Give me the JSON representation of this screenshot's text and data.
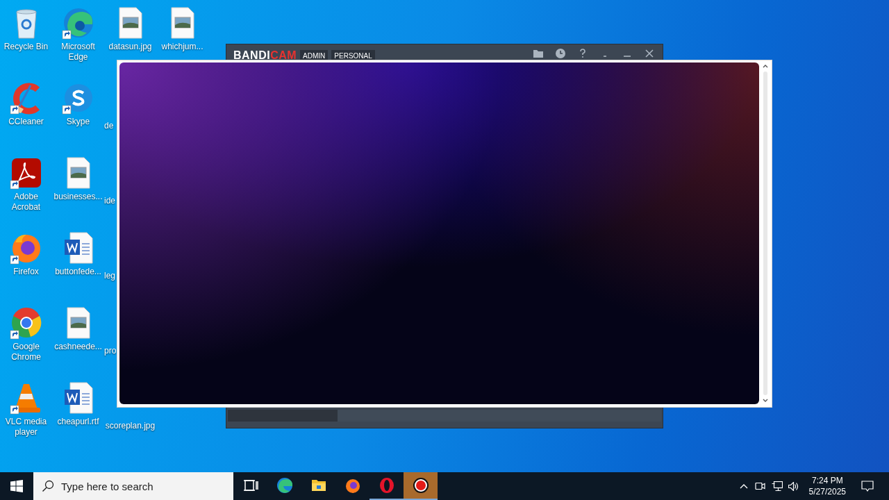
{
  "desktop": {
    "columns": [
      [
        {
          "label": "Recycle Bin",
          "kind": "bin",
          "shortcut": false
        },
        {
          "label": "CCleaner",
          "kind": "ccleaner",
          "shortcut": true
        },
        {
          "label": "Adobe Acrobat",
          "kind": "acrobat",
          "shortcut": true
        },
        {
          "label": "Firefox",
          "kind": "firefox",
          "shortcut": true
        },
        {
          "label": "Google Chrome",
          "kind": "chrome",
          "shortcut": true
        },
        {
          "label": "VLC media player",
          "kind": "vlc",
          "shortcut": true
        }
      ],
      [
        {
          "label": "Microsoft Edge",
          "kind": "edge",
          "shortcut": true
        },
        {
          "label": "Skype",
          "kind": "skype",
          "shortcut": true
        },
        {
          "label": "businesses...",
          "kind": "image",
          "shortcut": false
        },
        {
          "label": "buttonfede...",
          "kind": "word",
          "shortcut": false
        },
        {
          "label": "cashneede...",
          "kind": "image",
          "shortcut": false
        },
        {
          "label": "cheapurl.rtf",
          "kind": "word",
          "shortcut": false
        }
      ],
      [
        {
          "label": "datasun.jpg",
          "kind": "image",
          "shortcut": false
        },
        {
          "label": "de",
          "kind": "covered"
        },
        {
          "label": "ide",
          "kind": "covered"
        },
        {
          "label": "leg",
          "kind": "covered"
        },
        {
          "label": "pro",
          "kind": "covered"
        },
        {
          "label": "scoreplan.jpg",
          "kind": "label_only"
        }
      ],
      [
        {
          "label": "whichjum...",
          "kind": "image",
          "shortcut": false
        }
      ]
    ]
  },
  "recorder_window": {
    "logo": {
      "text": "BANDI",
      "accent": "CAM"
    },
    "tags": [
      "ADMIN",
      "PERSONAL"
    ],
    "title_buttons": [
      {
        "kind": "folder"
      },
      {
        "kind": "clock"
      },
      {
        "kind": "help"
      },
      {
        "kind": "mini"
      },
      {
        "kind": "minimize"
      },
      {
        "kind": "close"
      }
    ]
  },
  "overlay_window": {
    "kind": "gradient"
  },
  "taskbar": {
    "search": {
      "placeholder": "Type here to search"
    },
    "apps": [
      {
        "kind": "taskview",
        "running": false,
        "selected": false
      },
      {
        "kind": "edge",
        "running": false,
        "selected": false
      },
      {
        "kind": "explorer",
        "running": false,
        "selected": false
      },
      {
        "kind": "firefox",
        "running": false,
        "selected": false
      },
      {
        "kind": "opera",
        "running": true,
        "selected": false
      },
      {
        "kind": "record",
        "running": true,
        "selected": true
      }
    ],
    "tray": [
      {
        "kind": "chevron"
      },
      {
        "kind": "camera"
      },
      {
        "kind": "network"
      },
      {
        "kind": "volume"
      }
    ],
    "time": "7:24 PM",
    "date": "5/27/2025"
  }
}
